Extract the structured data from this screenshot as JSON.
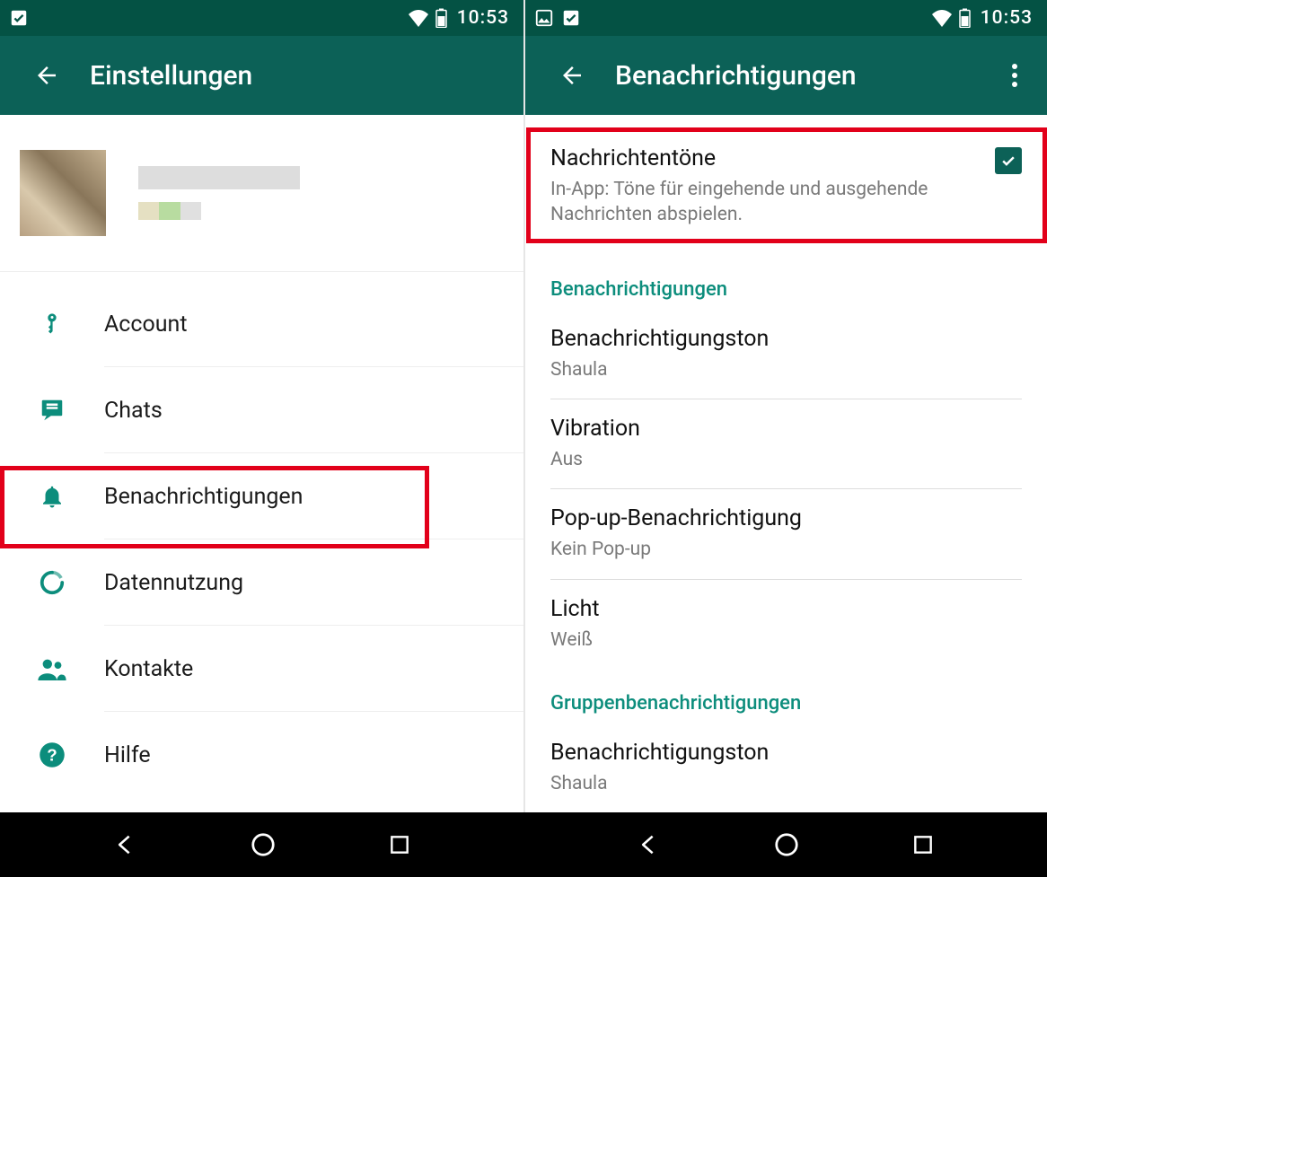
{
  "statusbar": {
    "clock": "10:53"
  },
  "left": {
    "title": "Einstellungen",
    "menu": [
      {
        "id": "account",
        "icon": "key",
        "label": "Account"
      },
      {
        "id": "chats",
        "icon": "chat",
        "label": "Chats"
      },
      {
        "id": "notif",
        "icon": "bell",
        "label": "Benachrichtigungen"
      },
      {
        "id": "data",
        "icon": "donut",
        "label": "Datennutzung"
      },
      {
        "id": "contacts",
        "icon": "contacts",
        "label": "Kontakte"
      },
      {
        "id": "help",
        "icon": "help",
        "label": "Hilfe"
      }
    ]
  },
  "right": {
    "title": "Benachrichtigungen",
    "conv_tones": {
      "title": "Nachrichtentöne",
      "sub": "In-App: Töne für eingehende und ausgehende Nachrichten abspielen.",
      "checked": true
    },
    "sections": [
      {
        "header": "Benachrichtigungen",
        "rows": [
          {
            "title": "Benachrichtigungston",
            "sub": "Shaula"
          },
          {
            "title": "Vibration",
            "sub": "Aus"
          },
          {
            "title": "Pop-up-Benachrichtigung",
            "sub": "Kein Pop-up"
          },
          {
            "title": "Licht",
            "sub": "Weiß"
          }
        ]
      },
      {
        "header": "Gruppenbenachrichtigungen",
        "rows": [
          {
            "title": "Benachrichtigungston",
            "sub": "Shaula"
          }
        ]
      }
    ]
  }
}
